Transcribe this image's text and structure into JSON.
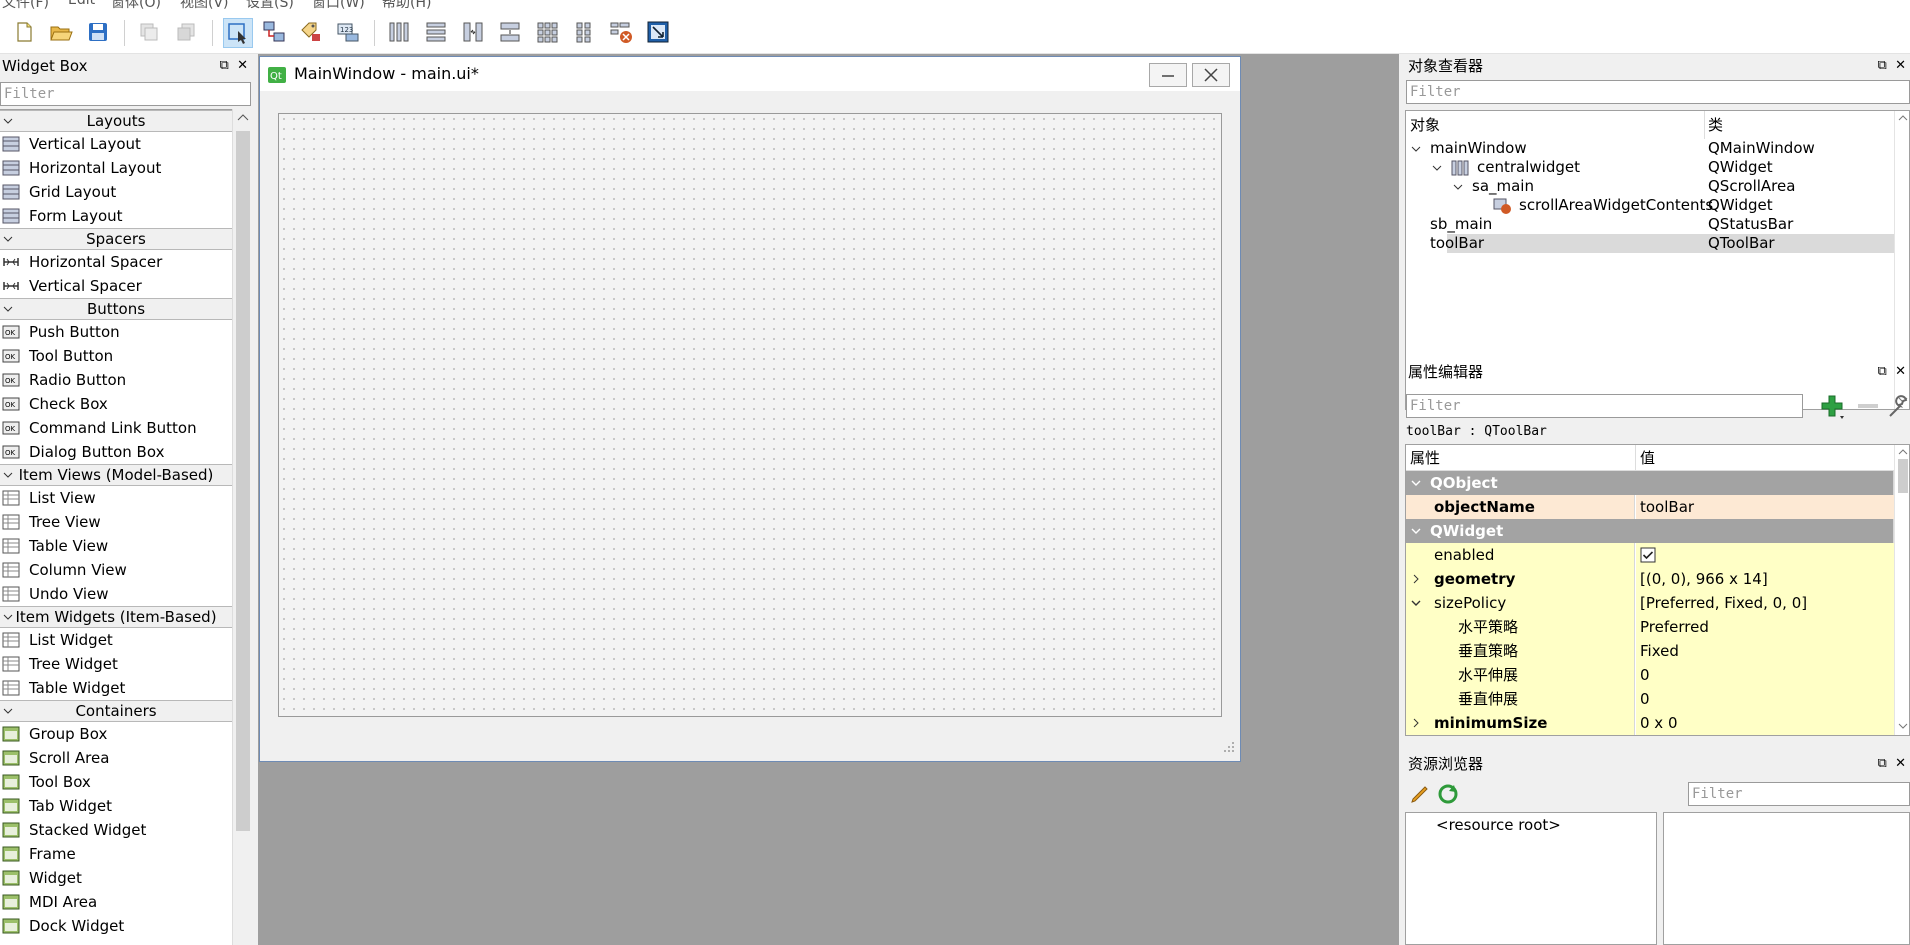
{
  "menubar": {
    "items": [
      "文件(F)",
      "Edit",
      "窗体(O)",
      "视图(V)",
      "设置(S)",
      "窗口(W)",
      "帮助(H)"
    ]
  },
  "widget_box": {
    "title": "Widget Box",
    "filter_placeholder": "Filter",
    "categories": [
      {
        "label": "Layouts",
        "items": [
          "Vertical Layout",
          "Horizontal Layout",
          "Grid Layout",
          "Form Layout"
        ]
      },
      {
        "label": "Spacers",
        "items": [
          "Horizontal Spacer",
          "Vertical Spacer"
        ]
      },
      {
        "label": "Buttons",
        "items": [
          "Push Button",
          "Tool Button",
          "Radio Button",
          "Check Box",
          "Command Link Button",
          "Dialog Button Box"
        ]
      },
      {
        "label": "Item Views (Model-Based)",
        "items": [
          "List View",
          "Tree View",
          "Table View",
          "Column View",
          "Undo View"
        ]
      },
      {
        "label": "Item Widgets (Item-Based)",
        "items": [
          "List Widget",
          "Tree Widget",
          "Table Widget"
        ]
      },
      {
        "label": "Containers",
        "items": [
          "Group Box",
          "Scroll Area",
          "Tool Box",
          "Tab Widget",
          "Stacked Widget",
          "Frame",
          "Widget",
          "MDI Area",
          "Dock Widget"
        ]
      }
    ]
  },
  "form_window": {
    "title": "MainWindow - main.ui*",
    "qt_badge": "Qt"
  },
  "object_inspector": {
    "title": "对象查看器",
    "filter_placeholder": "Filter",
    "col_object": "对象",
    "col_class": "类",
    "rows": [
      {
        "name": "mainWindow",
        "cls": "QMainWindow"
      },
      {
        "name": "centralwidget",
        "cls": "QWidget"
      },
      {
        "name": "sa_main",
        "cls": "QScrollArea"
      },
      {
        "name": "scrollAreaWidgetContents",
        "cls": "QWidget"
      },
      {
        "name": "sb_main",
        "cls": "QStatusBar"
      },
      {
        "name": "toolBar",
        "cls": "QToolBar"
      }
    ]
  },
  "property_editor": {
    "title": "属性编辑器",
    "filter_placeholder": "Filter",
    "context": "toolBar : QToolBar",
    "col_prop": "属性",
    "col_value": "值",
    "rows": [
      {
        "p": "QObject",
        "v": ""
      },
      {
        "p": "objectName",
        "v": "toolBar"
      },
      {
        "p": "QWidget",
        "v": ""
      },
      {
        "p": "enabled",
        "v": ""
      },
      {
        "p": "geometry",
        "v": "[(0, 0), 966 x 14]"
      },
      {
        "p": "sizePolicy",
        "v": "[Preferred, Fixed, 0, 0]"
      },
      {
        "p": "水平策略",
        "v": "Preferred"
      },
      {
        "p": "垂直策略",
        "v": "Fixed"
      },
      {
        "p": "水平伸展",
        "v": "0"
      },
      {
        "p": "垂直伸展",
        "v": "0"
      },
      {
        "p": "minimumSize",
        "v": "0 x 0"
      }
    ],
    "enabled_checked": true
  },
  "resource_browser": {
    "title": "资源浏览器",
    "filter_placeholder": "Filter",
    "root": "<resource root>"
  },
  "colors": {
    "group_header": "#a3a3a3",
    "property_yellow": "#ffffc6",
    "property_orange": "#fde9d4",
    "selection": "#dadada"
  }
}
